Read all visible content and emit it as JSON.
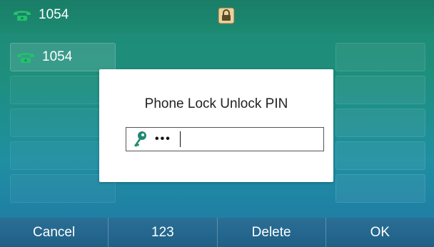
{
  "status_bar": {
    "account": "1054",
    "phone_icon": "phone-handset-icon",
    "lock_icon": "padlock-icon"
  },
  "line_keys": [
    {
      "label": "1054",
      "icon": "phone-handset-icon"
    }
  ],
  "dialog": {
    "title": "Phone Lock Unlock PIN",
    "pin_value": "•••",
    "field_icon": "key-icon"
  },
  "softkeys": [
    {
      "label": "Cancel"
    },
    {
      "label": "123"
    },
    {
      "label": "Delete"
    },
    {
      "label": "OK"
    }
  ],
  "colors": {
    "phone_icon": "#22c26a",
    "lock_icon": "#c9a760",
    "key_icon": "#1f8a74"
  }
}
